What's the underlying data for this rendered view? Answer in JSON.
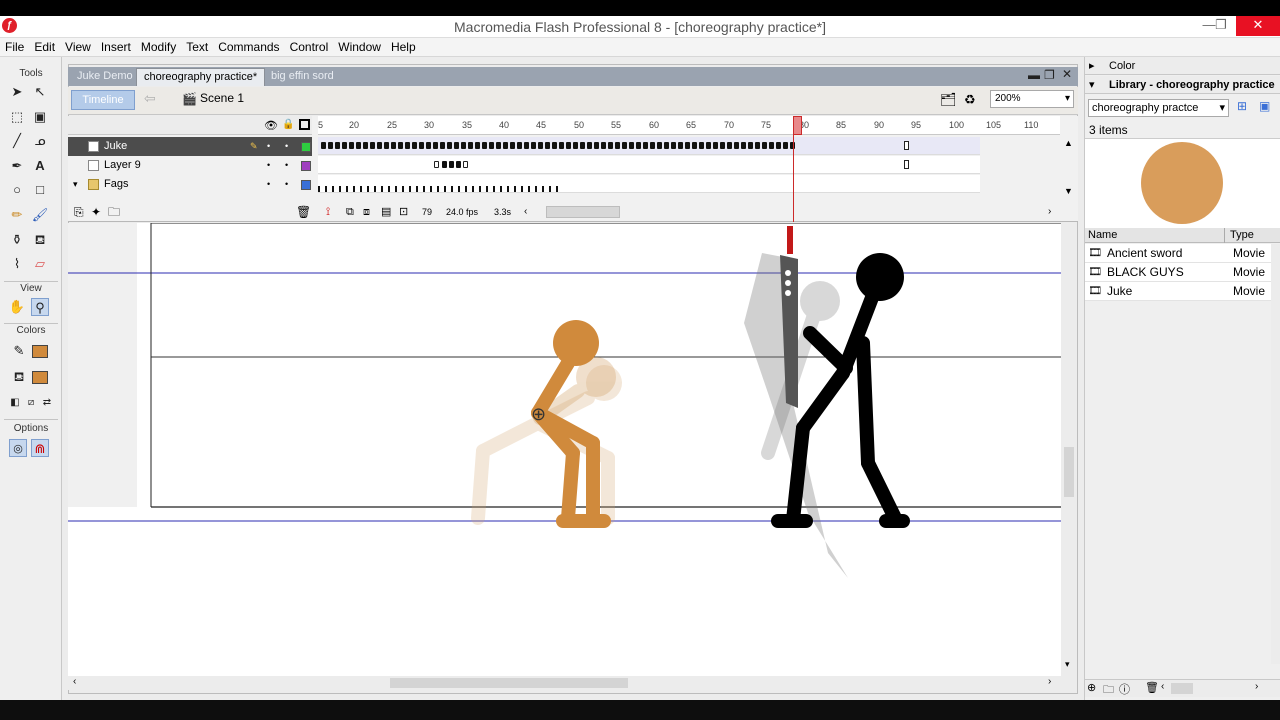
{
  "window": {
    "title": "Macromedia Flash Professional 8 - [choreography practice*]"
  },
  "menu": [
    "File",
    "Edit",
    "View",
    "Insert",
    "Modify",
    "Text",
    "Commands",
    "Control",
    "Window",
    "Help"
  ],
  "tools": {
    "title": "Tools",
    "view_label": "View",
    "colors_label": "Colors",
    "options_label": "Options"
  },
  "document_tabs": [
    "Juke Demo",
    "choreography practice*",
    "big effin sord"
  ],
  "edit_bar": {
    "timeline_button": "Timeline",
    "scene": "Scene 1",
    "zoom": "200%"
  },
  "timeline": {
    "layers": [
      {
        "name": "Juke",
        "color": "#2ecc40"
      },
      {
        "name": "Layer 9",
        "color": "#a040c0"
      },
      {
        "name": "Fags",
        "color": "#3a6fd6"
      }
    ],
    "ruler": [
      "5",
      "20",
      "25",
      "30",
      "35",
      "40",
      "45",
      "50",
      "55",
      "60",
      "65",
      "70",
      "75",
      "80",
      "85",
      "90",
      "95",
      "100",
      "105",
      "110"
    ],
    "current_frame": "79",
    "fps": "24.0 fps",
    "time": "3.3s"
  },
  "panels": {
    "color_title": "Color",
    "library_title": "Library - choreography practice",
    "library_select": "choreography practce",
    "item_count": "3 items",
    "columns": [
      "Name",
      "Type"
    ],
    "items": [
      {
        "name": "Ancient sword",
        "type": "Movie"
      },
      {
        "name": "BLACK GUYS",
        "type": "Movie"
      },
      {
        "name": "Juke",
        "type": "Movie"
      }
    ]
  }
}
